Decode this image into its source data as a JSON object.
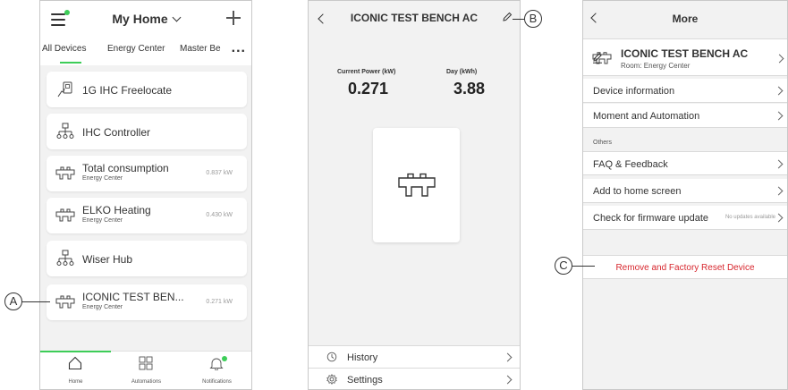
{
  "colors": {
    "accent": "#3dcd58",
    "danger": "#d7262d"
  },
  "phone1": {
    "header": {
      "title": "My Home",
      "menu_icon": "menu-icon",
      "add_icon": "plus-icon"
    },
    "tabs": [
      "All Devices",
      "Energy Center",
      "Master Be"
    ],
    "more_label": "...",
    "devices": [
      {
        "name": "1G IHC Freelocate",
        "icon": "switch-hand-icon"
      },
      {
        "name": "IHC Controller",
        "icon": "hub-icon"
      },
      {
        "name": "Total consumption",
        "sub": "Energy Center",
        "power": "0.837 kW",
        "icon": "meter-icon"
      },
      {
        "name": "ELKO Heating",
        "sub": "Energy Center",
        "power": "0.430 kW",
        "icon": "meter-icon"
      },
      {
        "name": "Wiser Hub",
        "icon": "hub-icon"
      },
      {
        "name": "ICONIC TEST BEN...",
        "sub": "Energy Center",
        "power": "0.271 kW",
        "icon": "meter-icon"
      }
    ],
    "nav": [
      {
        "label": "Home",
        "icon": "home-icon"
      },
      {
        "label": "Automations",
        "icon": "grid-icon"
      },
      {
        "label": "Notifications",
        "icon": "bell-icon"
      }
    ]
  },
  "phone2": {
    "title": "ICONIC TEST BENCH AC",
    "metrics": [
      {
        "label": "Current Power (kW)",
        "value": "0.271"
      },
      {
        "label": "Day (kWh)",
        "value": "3.88"
      }
    ],
    "rows": [
      {
        "label": "History",
        "icon": "history-icon"
      },
      {
        "label": "Settings",
        "icon": "settings-icon"
      }
    ]
  },
  "phone3": {
    "title": "More",
    "device": {
      "name": "ICONIC TEST BENCH AC",
      "room": "Room: Energy Center"
    },
    "rows": [
      {
        "label": "Device information"
      },
      {
        "label": "Moment and Automation"
      }
    ],
    "others_label": "Others",
    "others_rows": [
      {
        "label": "FAQ & Feedback"
      },
      {
        "label": "Add to home screen"
      },
      {
        "label": "Check for firmware update",
        "status": "No updates available"
      }
    ],
    "danger_label": "Remove and Factory Reset Device"
  },
  "callouts": {
    "a": "A",
    "b": "B",
    "c": "C"
  }
}
